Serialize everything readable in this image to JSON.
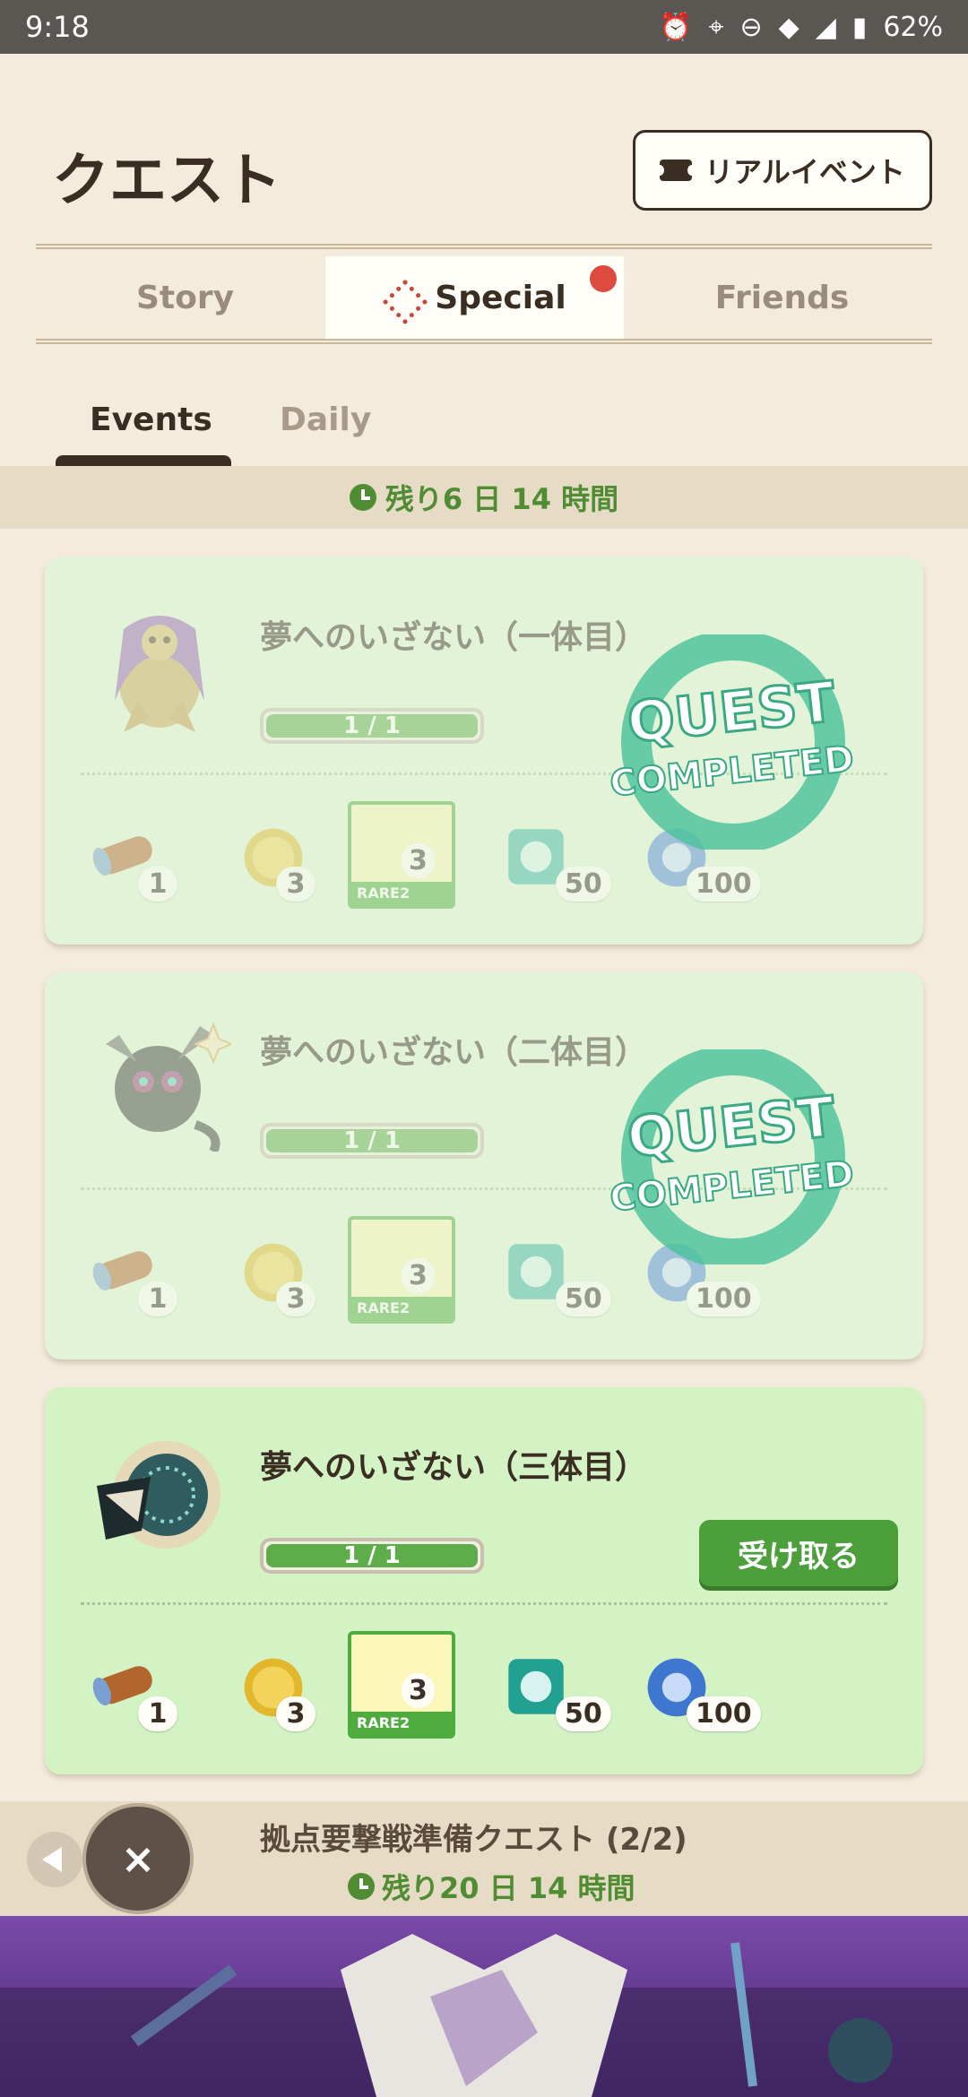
{
  "status_bar": {
    "time": "9:18",
    "battery": "62%"
  },
  "header": {
    "title": "クエスト",
    "real_event_label": "リアルイベント"
  },
  "main_tabs": [
    {
      "label": "Story"
    },
    {
      "label": "Special"
    },
    {
      "label": "Friends"
    }
  ],
  "sub_tabs": [
    {
      "label": "Events"
    },
    {
      "label": "Daily"
    }
  ],
  "time_banner": {
    "text": "残り6 日 14 時間"
  },
  "quests": [
    {
      "title": "夢へのいざない（一体目）",
      "progress": "1 / 1",
      "progress_fraction": 1.0,
      "status": "completed",
      "stamp_line1": "QUEST",
      "stamp_line2": "COMPLETED",
      "rewards": [
        "1",
        "3",
        "3",
        "50",
        "100"
      ],
      "rare_label": "RARE2"
    },
    {
      "title": "夢へのいざない（二体目）",
      "progress": "1 / 1",
      "progress_fraction": 1.0,
      "status": "completed",
      "stamp_line1": "QUEST",
      "stamp_line2": "COMPLETED",
      "rewards": [
        "1",
        "3",
        "3",
        "50",
        "100"
      ],
      "rare_label": "RARE2"
    },
    {
      "title": "夢へのいざない（三体目）",
      "progress": "1 / 1",
      "progress_fraction": 1.0,
      "status": "claimable",
      "accept_label": "受け取る",
      "rewards": [
        "1",
        "3",
        "3",
        "50",
        "100"
      ],
      "rare_label": "RARE2"
    }
  ],
  "bottom_bar": {
    "title": "拠点要撃戦準備クエスト (2/2)",
    "time": "残り20 日 14 時間",
    "close_label": "×"
  },
  "colors": {
    "accent_green": "#4f8c33",
    "card_bg": "#e2f3d7",
    "notification_red": "#dd4b3e"
  }
}
